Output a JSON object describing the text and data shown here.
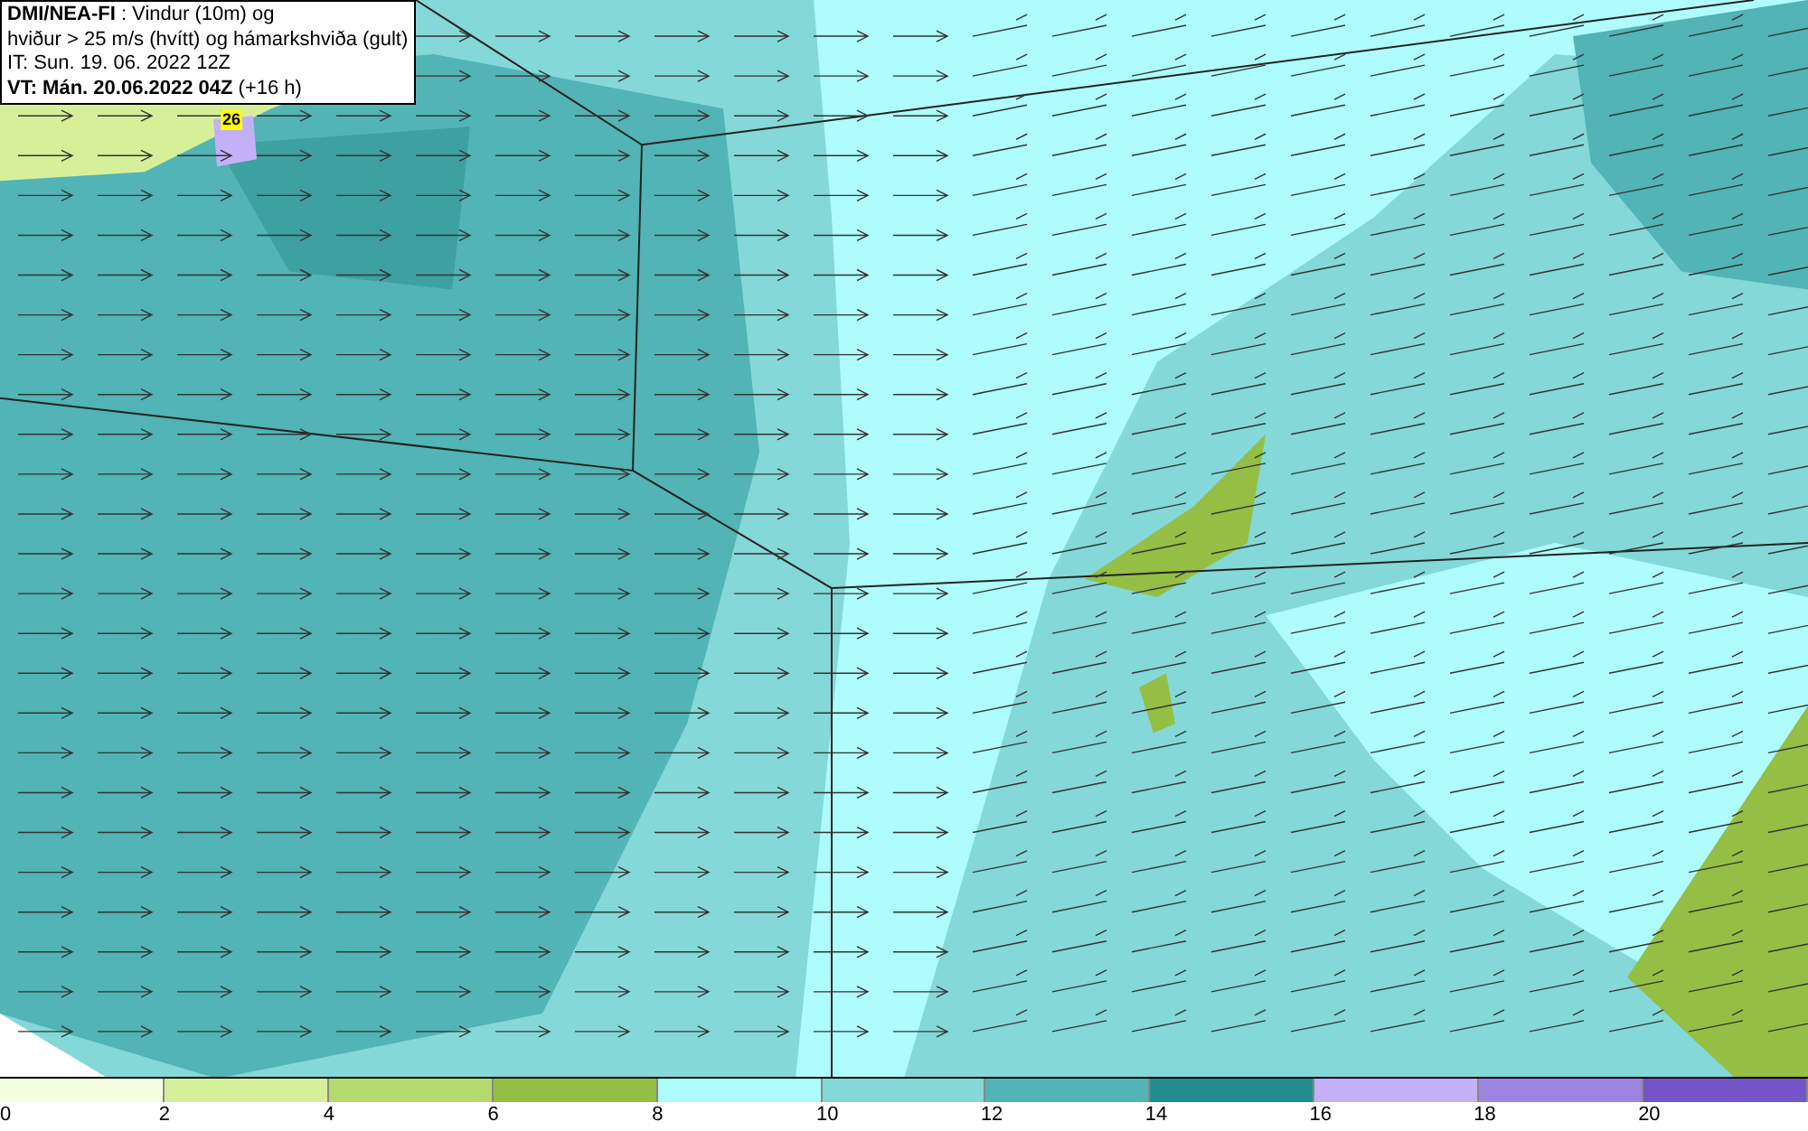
{
  "title_box": {
    "lines": [
      "**DMI/NEA-FI** : Vindur (10m) og",
      "hviður > 25 m/s (hvítt) og hámarkshviða (gult)",
      "IT: Sun. 19. 06. 2022 12Z",
      "**VT: Mán. 20.06.2022 04Z** (+16 h)"
    ]
  },
  "map": {
    "max_gust_label": "26"
  },
  "legend": {
    "bins": [
      {
        "color": "#f5fde0",
        "label": "0"
      },
      {
        "color": "#d6f09a",
        "label": "2"
      },
      {
        "color": "#b4da6e",
        "label": "4"
      },
      {
        "color": "#94bf44",
        "label": "6"
      },
      {
        "color": "#aefcfc",
        "label": "8"
      },
      {
        "color": "#84d8d8",
        "label": "10"
      },
      {
        "color": "#52b4b4",
        "label": "12"
      },
      {
        "color": "#238c8c",
        "label": "14"
      },
      {
        "color": "#c4b0f8",
        "label": "16"
      },
      {
        "color": "#9c84e0",
        "label": "18"
      },
      {
        "color": "#7454c8",
        "label": "20"
      }
    ]
  }
}
